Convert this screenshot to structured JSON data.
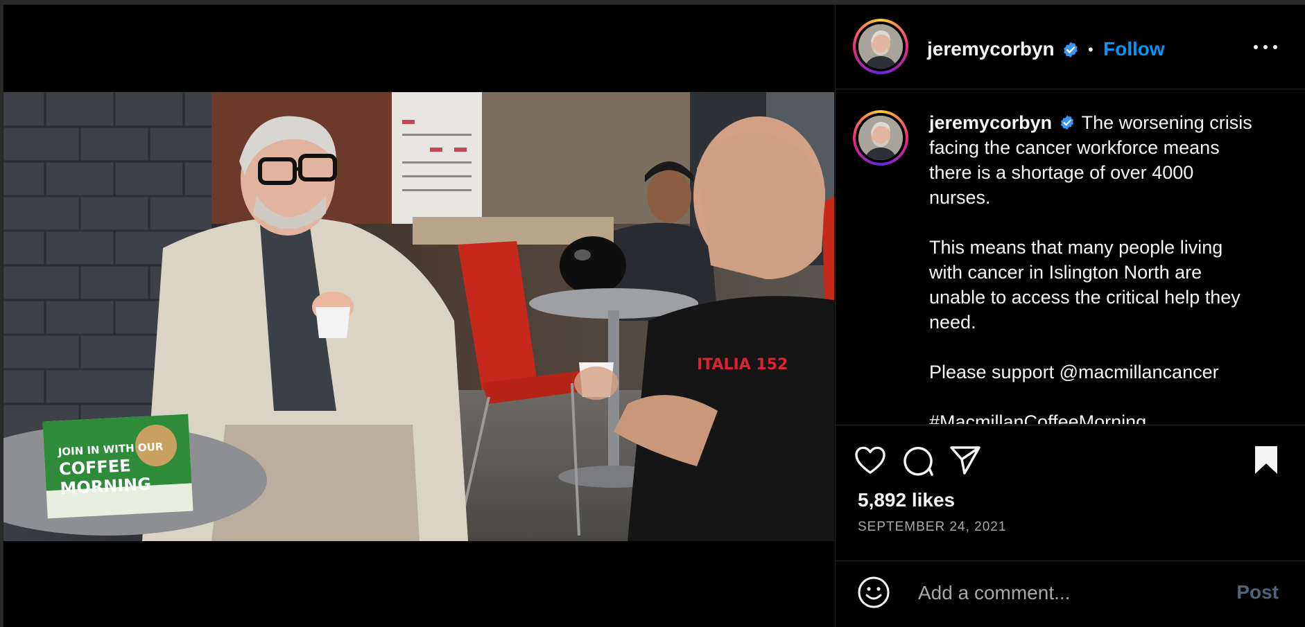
{
  "post": {
    "username": "jeremycorbyn",
    "follow_label": "Follow",
    "separator": "•",
    "caption": {
      "username": "jeremycorbyn",
      "paragraph_1": "The worsening crisis facing the cancer workforce means there is a shortage of over 4000 nurses.",
      "paragraph_2": "This means that many people living with cancer in Islington North are unable to access the critical help they need.",
      "paragraph_3": "Please support @macmillancancer",
      "paragraph_4": "#MacmillanCoffeeMorning"
    },
    "likes": "5,892 likes",
    "date": "SEPTEMBER 24, 2021",
    "comment_placeholder": "Add a comment...",
    "post_label": "Post"
  },
  "photo": {
    "leaflet_text": "JOIN IN WITH OUR COFFEE MORNING"
  },
  "icons": {
    "verified": "verified-badge-icon",
    "more": "more-options-icon",
    "like": "heart-icon",
    "comment": "comment-bubble-icon",
    "share": "paper-plane-icon",
    "save": "bookmark-icon",
    "emoji": "smiley-icon"
  },
  "colors": {
    "follow": "#0095f6",
    "verified": "#3897f0",
    "post_disabled": "#4e6479",
    "secondary_text": "#a8a8a8"
  }
}
